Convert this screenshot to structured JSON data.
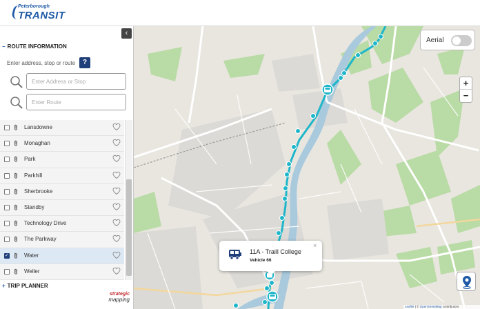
{
  "header": {
    "logo_top": "Peterborough",
    "logo_main": "TRANSIT"
  },
  "sidebar": {
    "collapse_icon": "chevron-left-icon",
    "route_info": {
      "toggle": "−",
      "title": "ROUTE INFORMATION"
    },
    "prompt": "Enter address, stop or route",
    "help_label": "?",
    "address_input": {
      "placeholder": "Enter Address or Stop",
      "value": ""
    },
    "route_input": {
      "placeholder": "Enter Route",
      "value": ""
    },
    "routes": [
      {
        "name": "Lansdowne",
        "checked": false
      },
      {
        "name": "Monaghan",
        "checked": false
      },
      {
        "name": "Park",
        "checked": false
      },
      {
        "name": "Parkhill",
        "checked": false
      },
      {
        "name": "Sherbrooke",
        "checked": false
      },
      {
        "name": "Standby",
        "checked": false
      },
      {
        "name": "Technology Drive",
        "checked": false
      },
      {
        "name": "The Parkway",
        "checked": false
      },
      {
        "name": "Water",
        "checked": true
      },
      {
        "name": "Weller",
        "checked": false
      }
    ],
    "trip_planner": {
      "toggle": "+",
      "title": "TRIP PLANNER"
    },
    "footer_logo": {
      "top": "strategic",
      "bottom": "mapping"
    }
  },
  "map": {
    "aerial_label": "Aerial",
    "aerial_enabled": false,
    "zoom_in": "+",
    "zoom_out": "−",
    "popup": {
      "title": "11A - Traill College",
      "subtitle": "Vehicle 66",
      "close": "×"
    },
    "attribution": {
      "leaflet": "Leaflet",
      "sep": " | © ",
      "osm": "OpenStreetMap",
      "tail": " contributors"
    },
    "colors": {
      "route": "#1fb6c9",
      "water": "#a9c9dc",
      "park": "#b3d9a1",
      "land": "#e9e6e0",
      "road": "#ffffff",
      "brand": "#1f5aa6"
    }
  }
}
